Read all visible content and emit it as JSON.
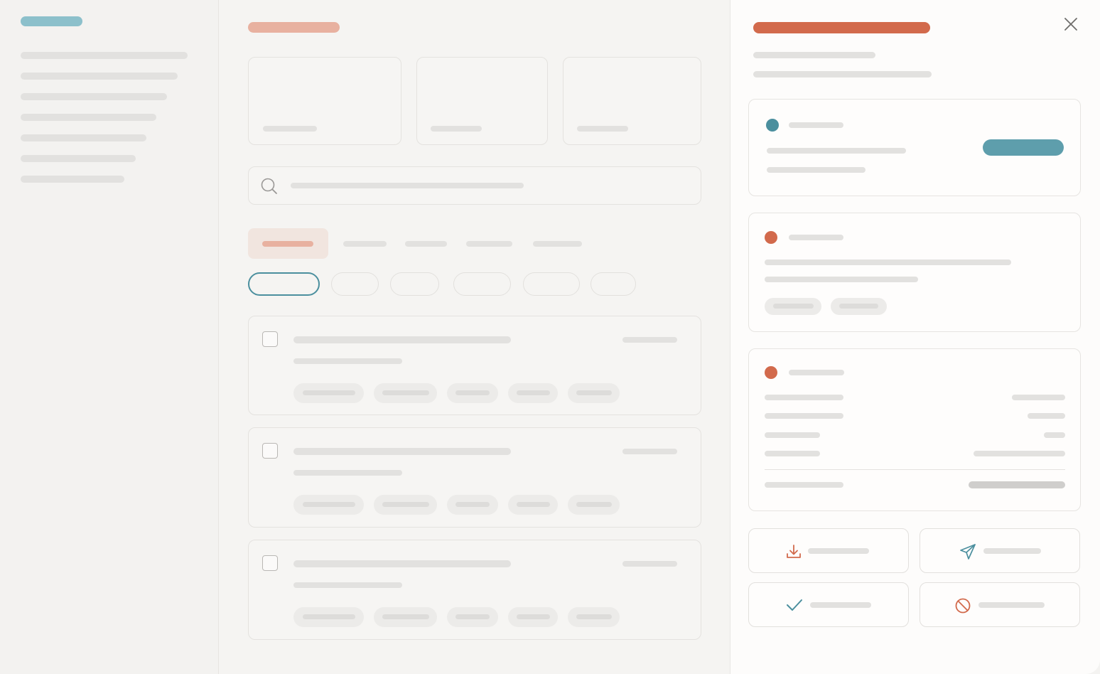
{
  "colors": {
    "accent_teal": "#4b8f9e",
    "accent_teal_light": "#8cc0cb",
    "accent_orange": "#d26a4c",
    "accent_orange_light": "#e8b1a0",
    "page_bg": "#f4f3f1",
    "panel_bg": "#fdfcfb",
    "placeholder": "#e2e1df"
  },
  "icons": {
    "search": "search-icon",
    "close": "close-icon",
    "download": "download-icon",
    "send": "send-icon",
    "check": "check-icon",
    "block": "block-icon"
  },
  "sidebar": {
    "item_count": 7
  },
  "main": {
    "stat_cards": 3,
    "tabs": 5,
    "active_tab_index": 0,
    "filter_chips": 6,
    "active_chip_index": 0,
    "rows": 3
  },
  "panel": {
    "cards": 3,
    "actions": [
      "download",
      "send",
      "approve",
      "reject"
    ]
  }
}
